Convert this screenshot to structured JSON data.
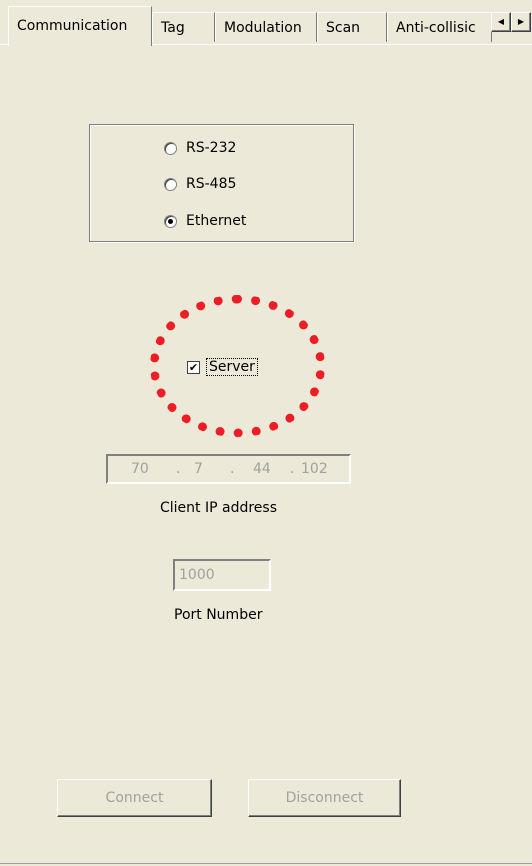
{
  "tabs": [
    {
      "label": "Communication",
      "active": true
    },
    {
      "label": "Tag",
      "active": false
    },
    {
      "label": "Modulation",
      "active": false
    },
    {
      "label": "Scan",
      "active": false
    },
    {
      "label": "Anti-collisic",
      "active": false
    }
  ],
  "tab_scroll": {
    "left_icon": "triangle-left-icon",
    "right_icon": "triangle-right-icon",
    "left": "◀",
    "right": "▶"
  },
  "interface": {
    "options": [
      {
        "label": "RS-232",
        "checked": false
      },
      {
        "label": "RS-485",
        "checked": false
      },
      {
        "label": "Ethernet",
        "checked": true
      }
    ]
  },
  "server": {
    "label": "Server",
    "checked": true,
    "check_glyph": "✔"
  },
  "highlight_color": "#ee1c24",
  "client_ip": {
    "octets": [
      "70",
      "7",
      "44",
      "102"
    ],
    "dot": ".",
    "label": "Client IP address"
  },
  "port": {
    "value": "1000",
    "label": "Port Number"
  },
  "buttons": {
    "connect": "Connect",
    "disconnect": "Disconnect"
  }
}
